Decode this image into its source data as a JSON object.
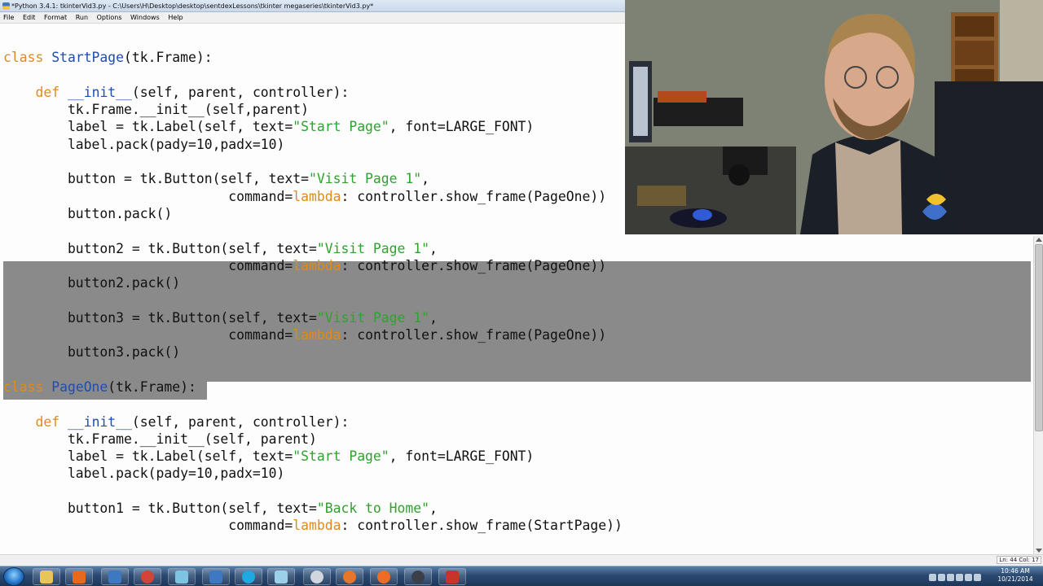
{
  "window": {
    "title": "*Python 3.4.1: tkinterVid3.py - C:\\Users\\H\\Desktop\\desktop\\sentdexLessons\\tkinter megaseries\\tkinterVid3.py*"
  },
  "menu": [
    "File",
    "Edit",
    "Format",
    "Run",
    "Options",
    "Windows",
    "Help"
  ],
  "code_lines": [
    [
      {
        "t": "",
        "c": "p"
      }
    ],
    [
      {
        "t": "class ",
        "c": "kw"
      },
      {
        "t": "StartPage",
        "c": "def"
      },
      {
        "t": "(tk.Frame):",
        "c": "p"
      }
    ],
    [
      {
        "t": "",
        "c": "p"
      }
    ],
    [
      {
        "t": "    ",
        "c": "p"
      },
      {
        "t": "def ",
        "c": "kw"
      },
      {
        "t": "__init__",
        "c": "def"
      },
      {
        "t": "(self, parent, controller):",
        "c": "p"
      }
    ],
    [
      {
        "t": "        tk.Frame.__init__(self,parent)",
        "c": "p"
      }
    ],
    [
      {
        "t": "        label = tk.Label(self, text=",
        "c": "p"
      },
      {
        "t": "\"Start Page\"",
        "c": "str"
      },
      {
        "t": ", font=LARGE_FONT)",
        "c": "p"
      }
    ],
    [
      {
        "t": "        label.pack(pady=10,padx=10)",
        "c": "p"
      }
    ],
    [
      {
        "t": "",
        "c": "p"
      }
    ],
    [
      {
        "t": "        button = tk.Button(self, text=",
        "c": "p"
      },
      {
        "t": "\"Visit Page 1\"",
        "c": "str"
      },
      {
        "t": ",",
        "c": "p"
      }
    ],
    [
      {
        "t": "                            command=",
        "c": "p"
      },
      {
        "t": "lambda",
        "c": "kw"
      },
      {
        "t": ": controller.show_frame(PageOne))",
        "c": "p"
      }
    ],
    [
      {
        "t": "        button.pack()",
        "c": "p"
      }
    ],
    [
      {
        "t": "",
        "c": "p"
      }
    ],
    [
      {
        "t": "        button2 = tk.Button(self, text=",
        "c": "p"
      },
      {
        "t": "\"Visit Page 1\"",
        "c": "str"
      },
      {
        "t": ",",
        "c": "p"
      }
    ],
    [
      {
        "t": "                            command=",
        "c": "p"
      },
      {
        "t": "lambda",
        "c": "kw"
      },
      {
        "t": ": controller.show_frame(PageOne))",
        "c": "p"
      }
    ],
    [
      {
        "t": "        button2.pack()",
        "c": "p"
      }
    ],
    [
      {
        "t": "",
        "c": "p"
      }
    ],
    [
      {
        "t": "        button3 = tk.Button(self, text=",
        "c": "p"
      },
      {
        "t": "\"Visit Page 1\"",
        "c": "str"
      },
      {
        "t": ",",
        "c": "p"
      }
    ],
    [
      {
        "t": "                            command=",
        "c": "p"
      },
      {
        "t": "lambda",
        "c": "kw"
      },
      {
        "t": ": controller.show_frame(PageOne))",
        "c": "p"
      }
    ],
    [
      {
        "t": "        button3.pack()",
        "c": "p"
      }
    ],
    [
      {
        "t": "",
        "c": "p"
      }
    ],
    [
      {
        "t": "class ",
        "c": "kw"
      },
      {
        "t": "PageOne",
        "c": "def"
      },
      {
        "t": "(tk.Frame):",
        "c": "p"
      }
    ],
    [
      {
        "t": "",
        "c": "p"
      }
    ],
    [
      {
        "t": "    ",
        "c": "p"
      },
      {
        "t": "def ",
        "c": "kw"
      },
      {
        "t": "__init__",
        "c": "def"
      },
      {
        "t": "(self, parent, controller):",
        "c": "p"
      }
    ],
    [
      {
        "t": "        tk.Frame.__init__(self, parent)",
        "c": "p"
      }
    ],
    [
      {
        "t": "        label = tk.Label(self, text=",
        "c": "p"
      },
      {
        "t": "\"Start Page\"",
        "c": "str"
      },
      {
        "t": ", font=LARGE_FONT)",
        "c": "p"
      }
    ],
    [
      {
        "t": "        label.pack(pady=10,padx=10)",
        "c": "p"
      }
    ],
    [
      {
        "t": "",
        "c": "p"
      }
    ],
    [
      {
        "t": "        button1 = tk.Button(self, text=",
        "c": "p"
      },
      {
        "t": "\"Back to Home\"",
        "c": "str"
      },
      {
        "t": ",",
        "c": "p"
      }
    ],
    [
      {
        "t": "                            command=",
        "c": "p"
      },
      {
        "t": "lambda",
        "c": "kw"
      },
      {
        "t": ": controller.show_frame(StartPage))",
        "c": "p"
      }
    ]
  ],
  "status": {
    "position": "Ln: 44  Col: 17"
  },
  "taskbar": {
    "items": [
      "explorer",
      "media-player",
      "idle",
      "chrome",
      "notepad",
      "idle-2",
      "skype",
      "files",
      "settings",
      "firefox",
      "recorder",
      "obs",
      "editor"
    ],
    "clock_time": "10:46 AM",
    "clock_date": "10/21/2014"
  },
  "colors": {
    "keyword": "#e08a1c",
    "definition": "#1f4eab",
    "string": "#2fa22f",
    "selection": "#8a8a8a"
  }
}
